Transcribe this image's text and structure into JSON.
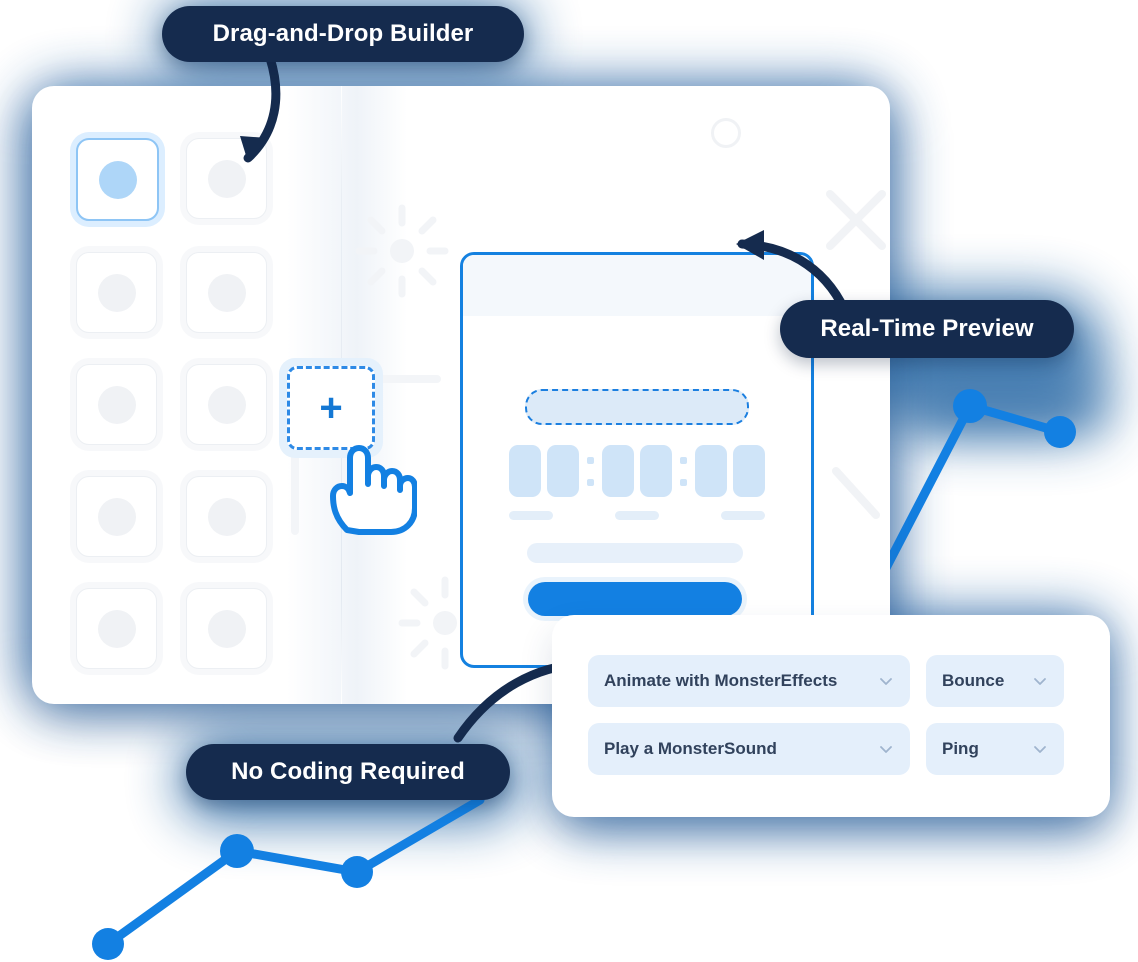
{
  "pills": [
    {
      "id": "drag-and-drop-builder",
      "label": "Drag-and-Drop Builder"
    },
    {
      "id": "real-time-preview",
      "label": "Real-Time Preview"
    },
    {
      "id": "no-coding-required",
      "label": "No Coding Required"
    }
  ],
  "palette": {
    "tiles": [
      {
        "selected": true
      },
      {
        "selected": false
      },
      {
        "selected": false
      },
      {
        "selected": false
      },
      {
        "selected": false
      },
      {
        "selected": false
      },
      {
        "selected": false
      },
      {
        "selected": false
      },
      {
        "selected": false
      },
      {
        "selected": false
      }
    ],
    "drop_zone": {
      "label": "+",
      "icon": "plus-icon"
    },
    "cursor_icon": "pointing-hand-cursor-icon"
  },
  "preview": {
    "input_placeholder_icon": "dashed-input-placeholder",
    "timer": {
      "groups": 3,
      "digits_per_group": 2,
      "separator": ":"
    },
    "cta_icon": "primary-button-placeholder"
  },
  "actions": {
    "rows": [
      {
        "action": {
          "label": "Animate with MonsterEffects",
          "chevron": "chevron-down-icon"
        },
        "value": {
          "label": "Bounce",
          "chevron": "chevron-down-icon"
        }
      },
      {
        "action": {
          "label": "Play a MonsterSound",
          "chevron": "chevron-down-icon"
        },
        "value": {
          "label": "Ping",
          "chevron": "chevron-down-icon"
        }
      }
    ]
  },
  "colors": {
    "brand_blue": "#1380e2",
    "navy": "#152b4e",
    "glow_blue": "#2f6aa8",
    "pale_blue": "#cfe4f8",
    "select_bg": "#e4effb",
    "select_text": "#31425c"
  }
}
